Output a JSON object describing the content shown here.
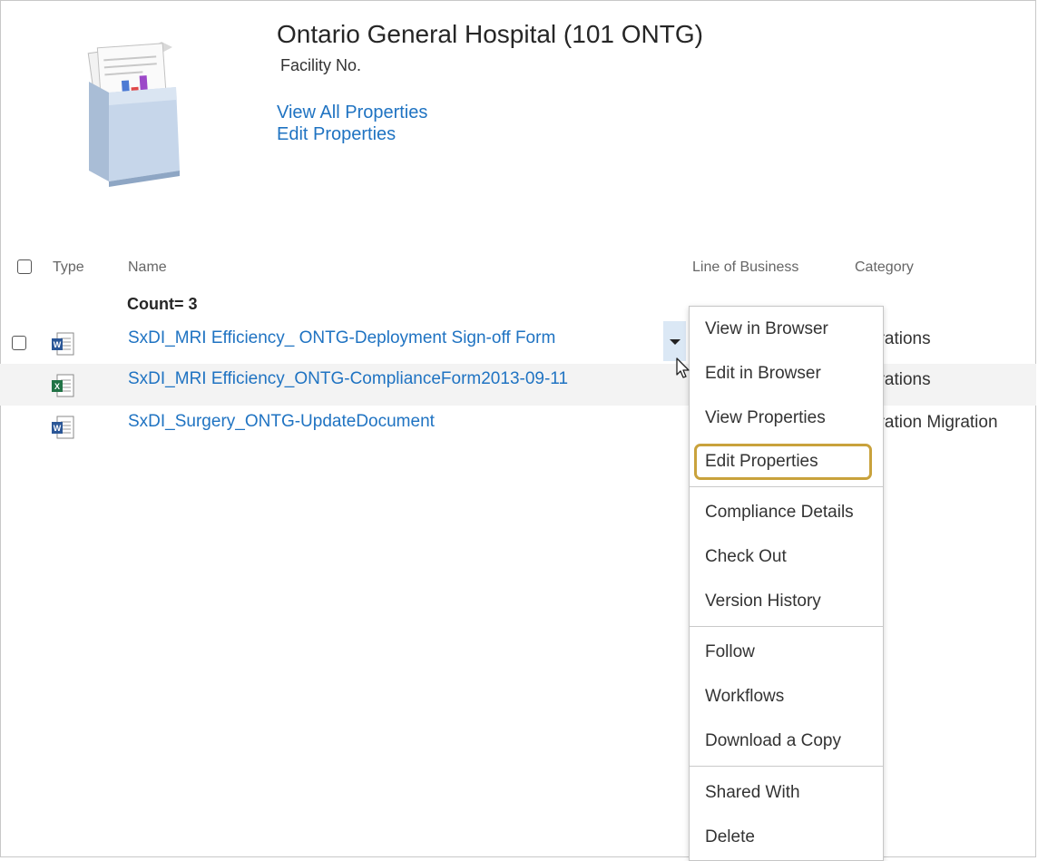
{
  "header": {
    "title": "Ontario General Hospital (101 ONTG)",
    "subtitle": "Facility No.",
    "links": [
      "View All Properties",
      "Edit Properties"
    ]
  },
  "table": {
    "columns": {
      "type": "Type",
      "name": "Name",
      "lob": "Line of Business",
      "category": "Category"
    },
    "count_label": "Count= 3",
    "rows": [
      {
        "type": "word-document",
        "name": "SxDI_MRI Efficiency_ ONTG-Deployment Sign-off Form",
        "category": "erations"
      },
      {
        "type": "excel-document",
        "name": "SxDI_MRI Efficiency_ONTG-ComplianceForm2013-09-11",
        "category": "erations"
      },
      {
        "type": "word-document",
        "name": "SxDI_Surgery_ONTG-UpdateDocument",
        "category": "gration Migration"
      }
    ]
  },
  "context_menu": {
    "groups": [
      [
        "View in Browser",
        "Edit in Browser",
        "View Properties",
        "Edit Properties"
      ],
      [
        "Compliance Details",
        "Check Out",
        "Version History"
      ],
      [
        "Follow",
        "Workflows",
        "Download a Copy"
      ],
      [
        "Shared With",
        "Delete"
      ]
    ],
    "highlighted": "Edit Properties"
  },
  "colors": {
    "link": "#1f73c2",
    "highlight_border": "#c9a23c",
    "dropdown_bg": "#dbe8f5",
    "row_alt": "#f3f3f3"
  }
}
